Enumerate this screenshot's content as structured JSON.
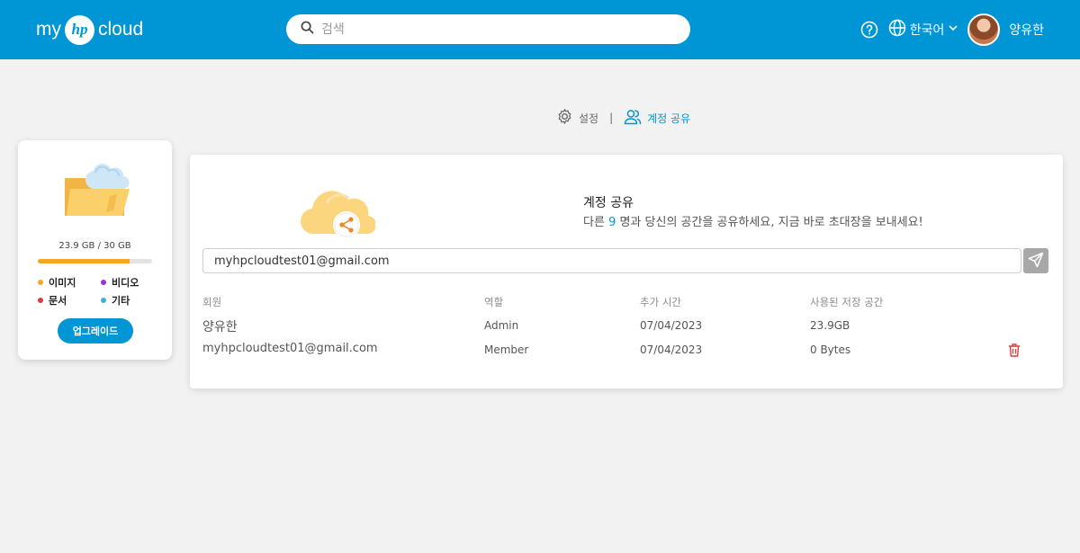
{
  "header": {
    "logo_my": "my",
    "logo_hp": "hp",
    "logo_cloud": "cloud",
    "search_placeholder": "검색",
    "language": "한국어",
    "username": "양유한"
  },
  "tabs": {
    "settings": "설정",
    "separator": "|",
    "share": "계정 공유"
  },
  "storage": {
    "usage_text": "23.9 GB / 30 GB",
    "used_fraction": 0.8,
    "legend": [
      {
        "label": "이미지",
        "color": "#f5a623"
      },
      {
        "label": "비디오",
        "color": "#9b30d9"
      },
      {
        "label": "문서",
        "color": "#e03a3a"
      },
      {
        "label": "기타",
        "color": "#3ab0e0"
      }
    ],
    "upgrade_label": "업그레이드"
  },
  "share": {
    "title": "계정 공유",
    "desc_before": "다른 ",
    "desc_count": "9",
    "desc_after": " 명과 당신의 공간을 공유하세요, 지금 바로 초대장을 보내세요!",
    "invite_value": "myhpcloudtest01@gmail.com"
  },
  "table": {
    "headers": [
      "회원",
      "역할",
      "추가 시간",
      "사용된 저장 공간"
    ],
    "rows": [
      {
        "member": "양유한",
        "role": "Admin",
        "added": "07/04/2023",
        "used": "23.9GB"
      },
      {
        "member": "myhpcloudtest01@gmail.com",
        "role": "Member",
        "added": "07/04/2023",
        "used": "0 Bytes"
      }
    ]
  },
  "colors": {
    "brand": "#0096d6",
    "delete": "#e03a3a"
  }
}
